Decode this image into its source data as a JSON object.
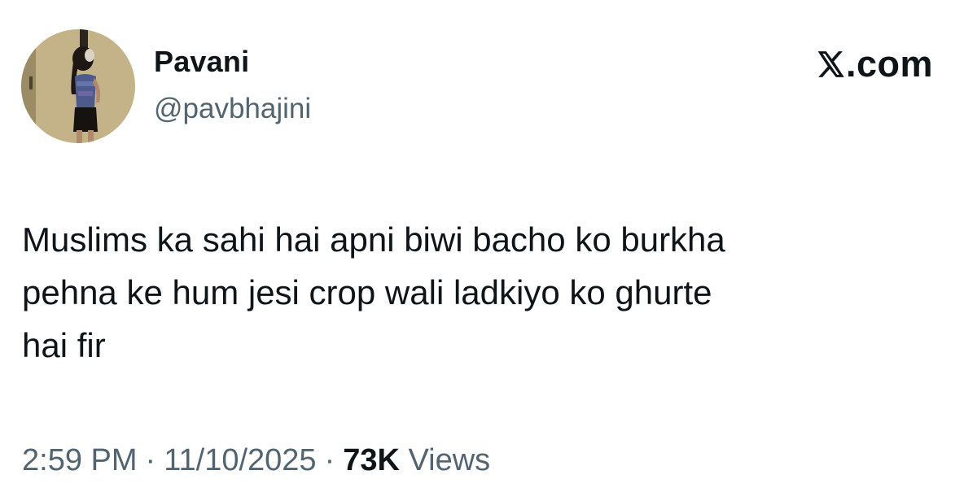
{
  "author": {
    "display_name": "Pavani",
    "handle": "@pavbhajini",
    "avatar": "profile-photo"
  },
  "brand": {
    "logo_icon": "x-logo-icon",
    "text": ".com"
  },
  "tweet": {
    "text": "Muslims ka sahi hai apni biwi bacho ko burkha\npehna ke hum jesi crop wali ladkiyo ko ghurte\nhai fir"
  },
  "meta": {
    "time": "2:59 PM",
    "separator": "·",
    "date": "11/10/2025",
    "views_count": "73K",
    "views_label": "Views"
  },
  "colors": {
    "primary_text": "#0f1419",
    "secondary_text": "#536471",
    "background": "#ffffff"
  }
}
